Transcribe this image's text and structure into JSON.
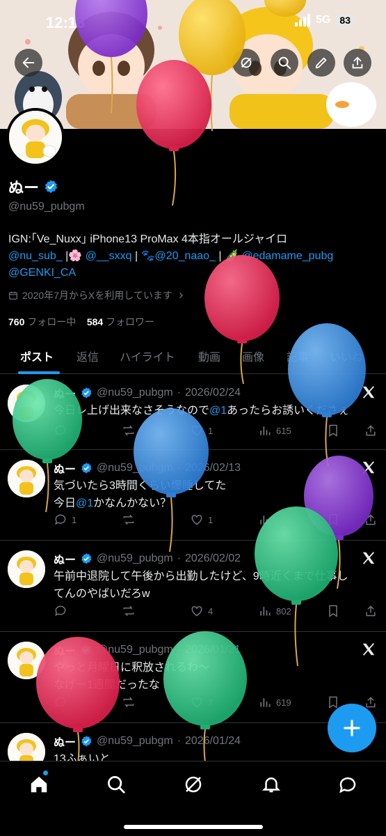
{
  "status_bar": {
    "time": "12:13",
    "network": "5G",
    "battery": "83"
  },
  "profile": {
    "name": "ぬー",
    "handle": "@nu59_pubgm",
    "bio_line1": "IGN:｢Ve_Nuxx｣ iPhone13 ProMax 4本指オールジャイロ",
    "bio_mentions_a": [
      "@nu_sub_",
      "🌸",
      "@__sxxq",
      "🐾",
      "@20_naao_",
      "🫛",
      "@edamame_pubg"
    ],
    "bio_mentions_b": "@GENKI_CA",
    "joined": "2020年7月からXを利用しています",
    "following_count": "760",
    "following_label": "フォロー中",
    "followers_count": "584",
    "followers_label": "フォロワー"
  },
  "tabs": [
    "ポスト",
    "返信",
    "ハイライト",
    "動画",
    "画像",
    "記事",
    "いいね"
  ],
  "posts": [
    {
      "name": "ぬー",
      "handle": "@nu59_pubgm",
      "date": "2026/02/24",
      "text_before": "今日レ上げ出来なさそうなので",
      "mention": "@1",
      "text_after": "あったらお誘いくださぇ",
      "replies": "",
      "reposts": "",
      "likes": "1",
      "views": "615"
    },
    {
      "name": "ぬー",
      "handle": "@nu59_pubgm",
      "date": "2026/02/13",
      "line1": "気づいたら3時間くらい爆睡してた",
      "line2_before": "今日",
      "mention": "@1",
      "line2_after": "かなんかない？",
      "replies": "1",
      "reposts": "",
      "likes": "1",
      "views": ""
    },
    {
      "name": "ぬー",
      "handle": "@nu59_pubgm",
      "date": "2026/02/02",
      "line1": "午前中退院して午後から出勤したけど、9時近くまで仕事し",
      "line2": "てんのやばいだろw",
      "replies": "",
      "reposts": "",
      "likes": "4",
      "views": "802"
    },
    {
      "name": "ぬー",
      "handle": "@nu59_pubgm",
      "date": "2026/01/31",
      "line1": "やっと月曜日に釈放されるわ〜",
      "line2": "なげー1週間だったな",
      "replies": "",
      "reposts": "",
      "likes": "2",
      "views": "619"
    },
    {
      "name": "ぬー",
      "handle": "@nu59_pubgm",
      "date": "2026/01/24",
      "line1": "13ふぁいと"
    }
  ],
  "colors": {
    "accent": "#1d9bf0",
    "balloon_purple": "#8e3ad9",
    "balloon_yellow": "#f2c21c",
    "balloon_red": "#e5325e",
    "balloon_blue": "#3a8fe0",
    "balloon_green": "#2ec485"
  }
}
